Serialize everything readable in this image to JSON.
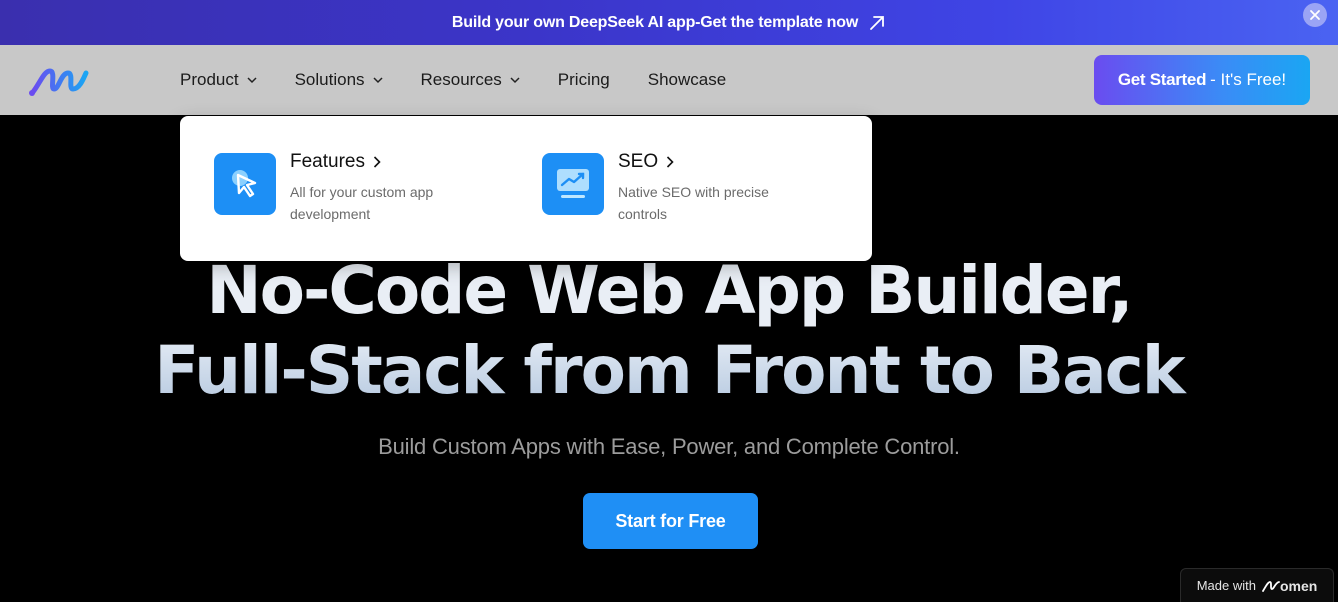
{
  "banner": {
    "text": "Build your own DeepSeek AI app-Get the template now",
    "arrow_icon": "arrow-up-right-icon",
    "close_icon": "close-icon"
  },
  "navbar": {
    "logo_icon": "momen-logo",
    "items": [
      {
        "label": "Product",
        "has_dropdown": true
      },
      {
        "label": "Solutions",
        "has_dropdown": true
      },
      {
        "label": "Resources",
        "has_dropdown": true
      },
      {
        "label": "Pricing",
        "has_dropdown": false
      },
      {
        "label": "Showcase",
        "has_dropdown": false
      }
    ],
    "cta": {
      "strong": "Get Started",
      "light": "- It's Free!"
    }
  },
  "dropdown": {
    "items": [
      {
        "title": "Features",
        "desc": "All for your custom app development",
        "icon": "cursor-icon"
      },
      {
        "title": "SEO",
        "desc": "Native SEO with precise controls",
        "icon": "chart-trend-icon"
      }
    ]
  },
  "hero": {
    "line1": "No-Code Web App Builder,",
    "line2": "Full-Stack from Front to Back",
    "subtitle": "Build Custom Apps with Ease, Power, and Complete Control.",
    "cta": "Start for Free"
  },
  "badge": {
    "prefix": "Made with",
    "brand": "omen"
  },
  "colors": {
    "accent_blue": "#1f8ff5",
    "banner_purple": "#3b35c9",
    "navbar_bg": "#c8c8c8"
  }
}
